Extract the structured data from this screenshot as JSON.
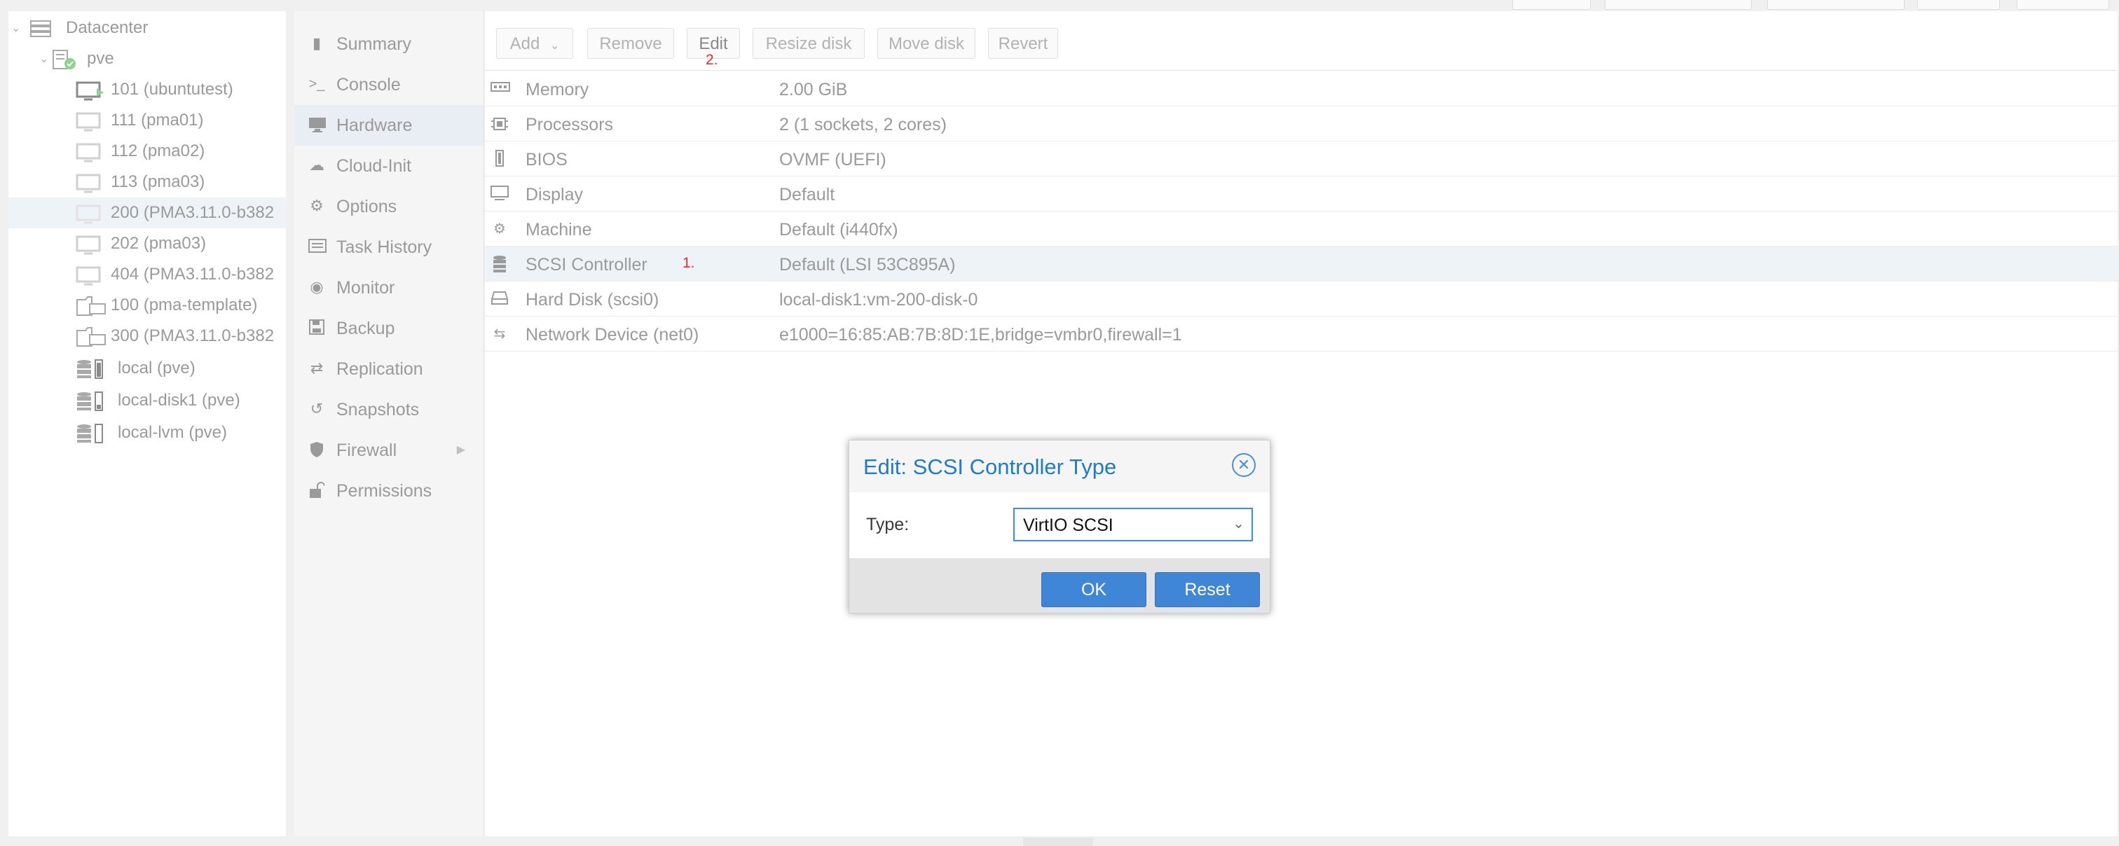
{
  "tree": {
    "items": [
      {
        "label": "Datacenter"
      },
      {
        "label": "pve"
      },
      {
        "label": "101 (ubuntutest)"
      },
      {
        "label": "111 (pma01)"
      },
      {
        "label": "112 (pma02)"
      },
      {
        "label": "113 (pma03)"
      },
      {
        "label": "200 (PMA3.11.0-b382"
      },
      {
        "label": "202 (pma03)"
      },
      {
        "label": "404 (PMA3.11.0-b382"
      },
      {
        "label": "100 (pma-template)"
      },
      {
        "label": "300 (PMA3.11.0-b382"
      },
      {
        "label": "local (pve)"
      },
      {
        "label": "local-disk1 (pve)"
      },
      {
        "label": "local-lvm (pve)"
      }
    ]
  },
  "nav": {
    "items": [
      {
        "label": "Summary",
        "icon": "book-icon"
      },
      {
        "label": "Console",
        "icon": "terminal-icon"
      },
      {
        "label": "Hardware",
        "icon": "desktop-icon"
      },
      {
        "label": "Cloud-Init",
        "icon": "cloud-icon"
      },
      {
        "label": "Options",
        "icon": "gear-icon"
      },
      {
        "label": "Task History",
        "icon": "list-icon"
      },
      {
        "label": "Monitor",
        "icon": "eye-icon"
      },
      {
        "label": "Backup",
        "icon": "floppy-icon"
      },
      {
        "label": "Replication",
        "icon": "retweet-icon"
      },
      {
        "label": "Snapshots",
        "icon": "history-icon"
      },
      {
        "label": "Firewall",
        "icon": "shield-icon"
      },
      {
        "label": "Permissions",
        "icon": "unlock-icon"
      }
    ]
  },
  "toolbar": {
    "add": "Add",
    "remove": "Remove",
    "edit": "Edit",
    "resize": "Resize disk",
    "move": "Move disk",
    "revert": "Revert"
  },
  "hardware": {
    "rows": [
      {
        "name": "Memory",
        "value": "2.00 GiB",
        "icon": "memory-icon"
      },
      {
        "name": "Processors",
        "value": "2 (1 sockets, 2 cores)",
        "icon": "cpu-icon"
      },
      {
        "name": "BIOS",
        "value": "OVMF (UEFI)",
        "icon": "chip-icon"
      },
      {
        "name": "Display",
        "value": "Default",
        "icon": "monitor-icon"
      },
      {
        "name": "Machine",
        "value": "Default (i440fx)",
        "icon": "cogs-icon"
      },
      {
        "name": "SCSI Controller",
        "value": "Default (LSI 53C895A)",
        "icon": "database-icon"
      },
      {
        "name": "Hard Disk (scsi0)",
        "value": "local-disk1:vm-200-disk-0",
        "icon": "hdd-icon"
      },
      {
        "name": "Network Device (net0)",
        "value": "e1000=16:85:AB:7B:8D:1E,bridge=vmbr0,firewall=1",
        "icon": "exchange-icon"
      }
    ]
  },
  "markers": {
    "one": "1.",
    "two": "2."
  },
  "dialog": {
    "title": "Edit: SCSI Controller Type",
    "type_label": "Type:",
    "type_value": "VirtIO SCSI",
    "ok": "OK",
    "reset": "Reset"
  },
  "colors": {
    "accent": "#3f86d6",
    "title_blue": "#1f7bc7",
    "marker_red": "#e0302f",
    "selection": "#eef3f8"
  }
}
